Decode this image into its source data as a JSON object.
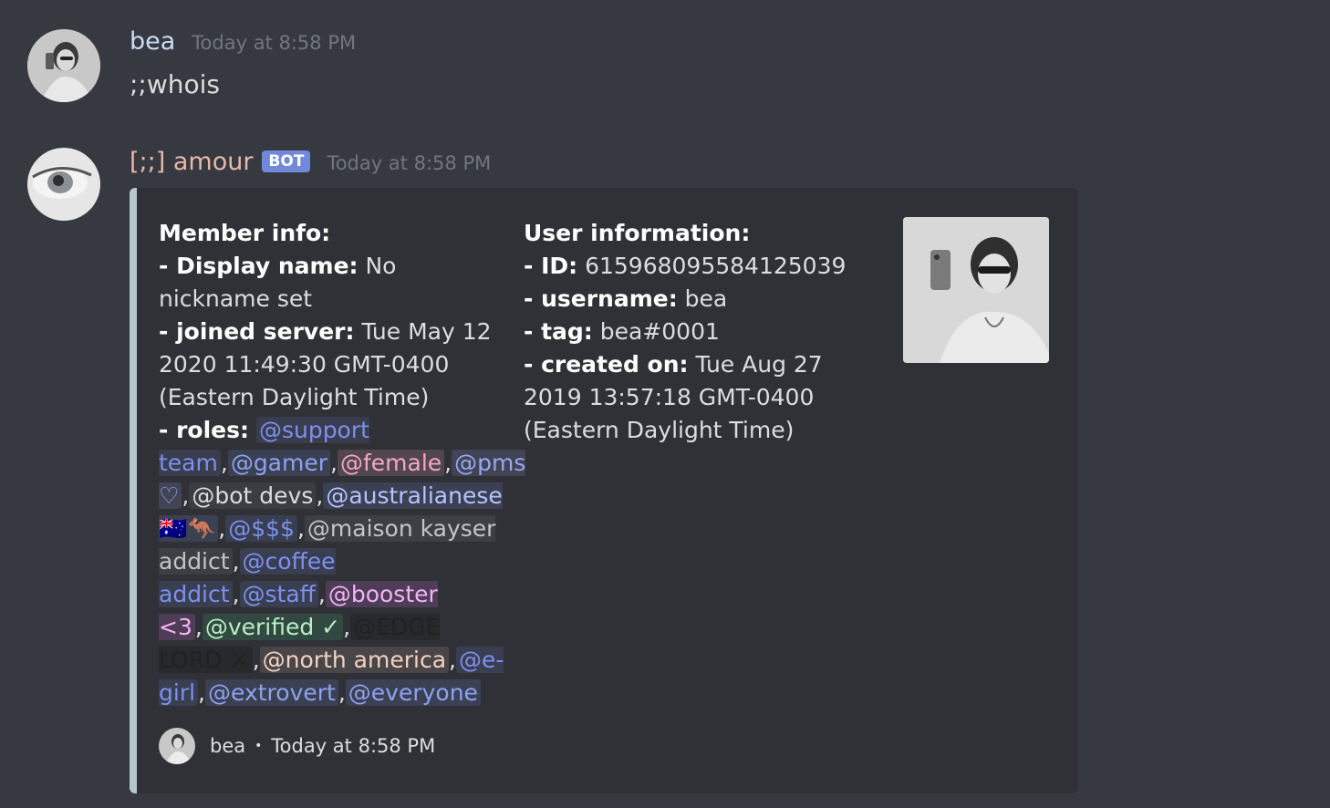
{
  "messages": [
    {
      "author": "bea",
      "timestamp": "Today at 8:58 PM",
      "content": ";;whois",
      "avatar_icon": "user-avatar-photo"
    },
    {
      "author": "[;;] amour",
      "badge": "BOT",
      "timestamp": "Today at 8:58 PM",
      "avatar_icon": "eye-avatar-photo"
    }
  ],
  "embed": {
    "accent_color": "#b5c9cc",
    "member_info": {
      "title": "Member info:",
      "display_name_label": "- Display name:",
      "display_name_value": "No nickname set",
      "joined_label": "- joined server:",
      "joined_value": "Tue May 12 2020 11:49:30 GMT-0400 (Eastern Daylight Time)",
      "roles_label": "- roles:",
      "roles": [
        {
          "text": "@support team",
          "color": "#7d8fef"
        },
        {
          "text": "@gamer",
          "color": "#8ea1f0"
        },
        {
          "text": "@female",
          "color": "#f2a8c0"
        },
        {
          "text": "@pms ♡",
          "color": "#9aa6f2"
        },
        {
          "text": "@bot devs",
          "color": "#dcddde"
        },
        {
          "text": "@australianese 🇦🇺🦘",
          "color": "#b7c2ff"
        },
        {
          "text": "@$$$",
          "color": "#7d8fef"
        },
        {
          "text": "@maison kayser addict",
          "color": "#c4c4c4"
        },
        {
          "text": "@coffee addict",
          "color": "#7d8fef"
        },
        {
          "text": "@staff",
          "color": "#7d8fef"
        },
        {
          "text": "@booster <3",
          "color": "#f3b2f5"
        },
        {
          "text": "@verified ✓",
          "color": "#b7f0c0"
        },
        {
          "text": "@EDGE LORD ⚔",
          "color": "#1f2125"
        },
        {
          "text": "@north america",
          "color": "#f0d2c4"
        },
        {
          "text": "@e-girl",
          "color": "#7d8fef"
        },
        {
          "text": "@extrovert",
          "color": "#8ea1f0"
        },
        {
          "text": "@everyone",
          "color": "#8ea1f0"
        }
      ],
      "roles_separator": ","
    },
    "user_info": {
      "title": "User information:",
      "id_label": "- ID:",
      "id_value": "615968095584125039",
      "username_label": "- username:",
      "username_value": "bea",
      "tag_label": "- tag:",
      "tag_value": "bea#0001",
      "created_label": "- created on:",
      "created_value": "Tue Aug 27 2019 13:57:18 GMT-0400 (Eastern Daylight Time)"
    },
    "thumbnail_icon": "profile-thumbnail-photo",
    "footer": {
      "author": "bea",
      "separator": "•",
      "timestamp": "Today at 8:58 PM",
      "icon": "footer-avatar-photo"
    }
  }
}
